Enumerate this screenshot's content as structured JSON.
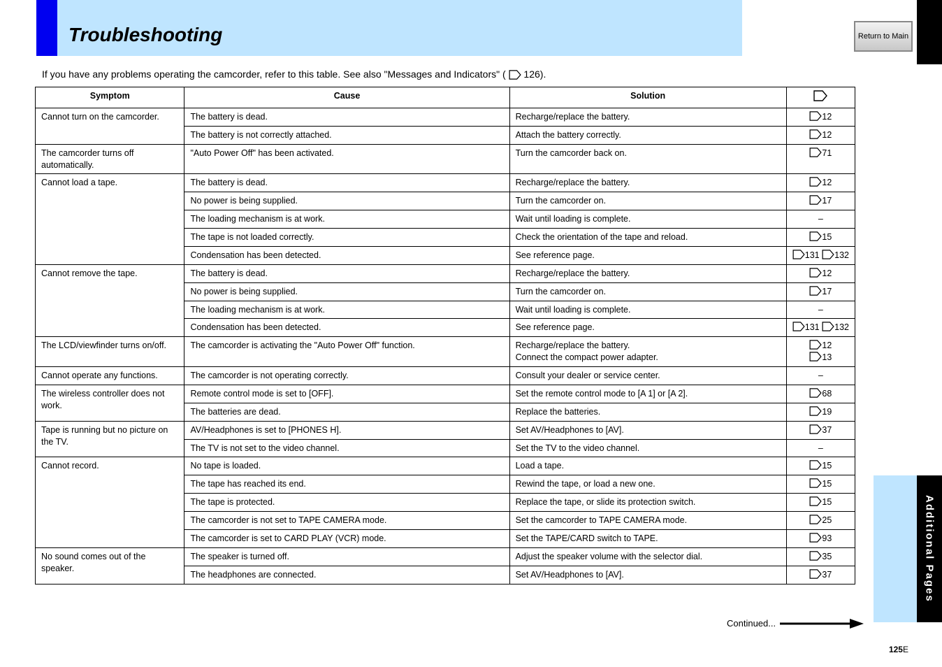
{
  "page": {
    "banner_title": "Troubleshooting",
    "grey_button_label": "Return to Main",
    "intro_prefix": "If you have any problems operating the camcorder, refer to this table. See also \"Messages and Indicators\" (",
    "intro_pages": "126",
    "intro_suffix": ").",
    "table": {
      "headers": [
        "Symptom",
        "Cause",
        "Solution",
        ""
      ],
      "pagecol_header_icon": "page",
      "rows": [
        {
          "symptom": "Cannot turn on the camcorder.",
          "span": 2,
          "cells": [
            {
              "cause": "The battery is dead.",
              "solution": "Recharge/replace the battery.",
              "pages": [
                "12"
              ]
            },
            {
              "cause": "The battery is not correctly attached.",
              "solution": "Attach the battery correctly.",
              "pages": [
                "12"
              ]
            }
          ]
        },
        {
          "symptom": "The camcorder turns off automatically.",
          "span": 1,
          "cells": [
            {
              "cause": "\"Auto Power Off\" has been activated.",
              "solution": "Turn the camcorder back on.",
              "pages": [
                "71"
              ]
            }
          ]
        },
        {
          "symptom": "Cannot load a tape.",
          "span": 5,
          "cells": [
            {
              "cause": "The battery is dead.",
              "solution": "Recharge/replace the battery.",
              "pages": [
                "12"
              ]
            },
            {
              "cause": "No power is being supplied.",
              "solution": "Turn the camcorder on.",
              "pages": [
                "17"
              ]
            },
            {
              "cause": "The loading mechanism is at work.",
              "solution": "Wait until loading is complete.",
              "pages": [
                "–"
              ]
            },
            {
              "cause": "The tape is not loaded correctly.",
              "solution": "Check the orientation of the tape and reload.",
              "pages": [
                "15"
              ]
            },
            {
              "cause": "Condensation has been detected.",
              "solution": "See reference page.",
              "pages": [
                "131",
                "132"
              ]
            }
          ]
        },
        {
          "symptom": "Cannot remove the tape.",
          "span": 4,
          "cells": [
            {
              "cause": "The battery is dead.",
              "solution": "Recharge/replace the battery.",
              "pages": [
                "12"
              ]
            },
            {
              "cause": "No power is being supplied.",
              "solution": "Turn the camcorder on.",
              "pages": [
                "17"
              ]
            },
            {
              "cause": "The loading mechanism is at work.",
              "solution": "Wait until loading is complete.",
              "pages": [
                "–"
              ]
            },
            {
              "cause": "Condensation has been detected.",
              "solution": "See reference page.",
              "pages": [
                "131",
                "132"
              ]
            }
          ]
        },
        {
          "symptom": "The LCD/viewfinder turns on/off.",
          "span": 1,
          "cells": [
            {
              "cause": "The camcorder is activating the \"Auto Power Off\" function.",
              "solution": "Recharge/replace the battery.\nConnect the compact power adapter.",
              "pages": [
                "12",
                "13"
              ]
            }
          ]
        },
        {
          "symptom": "Cannot operate any functions.",
          "span": 1,
          "cells": [
            {
              "cause": "The camcorder is not operating correctly.",
              "solution": "Consult your dealer or service center.",
              "pages": [
                "–"
              ]
            }
          ]
        },
        {
          "symptom": "The wireless controller does not work.",
          "span": 2,
          "cells": [
            {
              "cause": "Remote control mode is set to [OFF].",
              "solution": "Set the remote control mode to [A 1] or [A 2].",
              "pages": [
                "68"
              ]
            },
            {
              "cause": "The batteries are dead.",
              "solution": "Replace the batteries.",
              "pages": [
                "19"
              ]
            }
          ]
        },
        {
          "symptom": "Tape is running but no picture on the TV.",
          "span": 2,
          "cells": [
            {
              "cause": "AV/Headphones is set to [PHONES H].",
              "solution": "Set AV/Headphones to [AV].",
              "pages": [
                "37"
              ]
            },
            {
              "cause": "The TV is not set to the video channel.",
              "solution": "Set the TV to the video channel.",
              "pages": [
                "–"
              ]
            }
          ]
        },
        {
          "symptom": "Cannot record.",
          "span": 5,
          "cells": [
            {
              "cause": "No tape is loaded.",
              "solution": "Load a tape.",
              "pages": [
                "15"
              ]
            },
            {
              "cause": "The tape has reached its end.",
              "solution": "Rewind the tape, or load a new one.",
              "pages": [
                "15"
              ]
            },
            {
              "cause": "The tape is protected.",
              "solution": "Replace the tape, or slide its protection switch.",
              "pages": [
                "15"
              ]
            },
            {
              "cause": "The camcorder is not set to TAPE CAMERA mode.",
              "solution": "Set the camcorder to TAPE CAMERA mode.",
              "pages": [
                "25"
              ]
            },
            {
              "cause": "The camcorder is set to CARD PLAY (VCR) mode.",
              "solution": "Set the TAPE/CARD switch to TAPE.",
              "pages": [
                "93"
              ]
            }
          ]
        },
        {
          "symptom": "No sound comes out of the speaker.",
          "span": 2,
          "cells": [
            {
              "cause": "The speaker is turned off.",
              "solution": "Adjust the speaker volume with the selector dial.",
              "pages": [
                "35"
              ]
            },
            {
              "cause": "The headphones are connected.",
              "solution": "Set AV/Headphones to [AV].",
              "pages": [
                "37"
              ]
            }
          ]
        }
      ]
    },
    "continued_label": "Continued...",
    "side_tab_label": "Additional Pages",
    "page_number": "125",
    "page_number_suffix": "E"
  }
}
